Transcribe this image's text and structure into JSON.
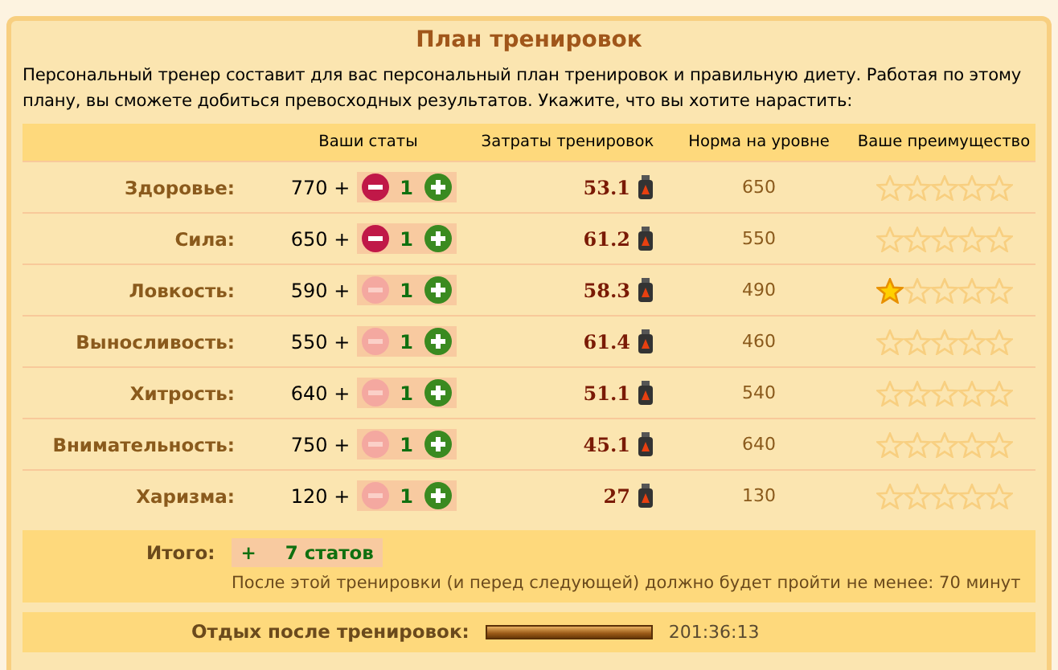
{
  "title": "План тренировок",
  "intro": "Персональный тренер составит для вас персональный план тренировок и правильную диету. Работая по этому плану, вы сможете добиться превосходных результатов. Укажите, что вы хотите нарастить:",
  "columns": [
    "Ваши статы",
    "Затраты тренировок",
    "Норма на уровне",
    "Ваше преимущество"
  ],
  "rows": [
    {
      "name": "Здоровье:",
      "value": "770 +",
      "minus_enabled": true,
      "amount": "1",
      "cost": "53.1",
      "norm": "650",
      "stars": 0
    },
    {
      "name": "Сила:",
      "value": "650 +",
      "minus_enabled": true,
      "amount": "1",
      "cost": "61.2",
      "norm": "550",
      "stars": 0
    },
    {
      "name": "Ловкость:",
      "value": "590 +",
      "minus_enabled": false,
      "amount": "1",
      "cost": "58.3",
      "norm": "490",
      "stars": 1
    },
    {
      "name": "Выносливость:",
      "value": "550 +",
      "minus_enabled": false,
      "amount": "1",
      "cost": "61.4",
      "norm": "460",
      "stars": 0
    },
    {
      "name": "Хитрость:",
      "value": "640 +",
      "minus_enabled": false,
      "amount": "1",
      "cost": "51.1",
      "norm": "540",
      "stars": 0
    },
    {
      "name": "Внимательность:",
      "value": "750 +",
      "minus_enabled": false,
      "amount": "1",
      "cost": "45.1",
      "norm": "640",
      "stars": 0
    },
    {
      "name": "Харизма:",
      "value": "120 +",
      "minus_enabled": false,
      "amount": "1",
      "cost": "27",
      "norm": "130",
      "stars": 0
    }
  ],
  "total": {
    "label": "Итого:",
    "sign": "+",
    "value": "7 статов",
    "note": "После этой тренировки (и перед следующей) должно будет пройти не менее: 70 минут"
  },
  "rest": {
    "label": "Отдых после тренировок:",
    "level": 1,
    "time": "201:36:13"
  }
}
